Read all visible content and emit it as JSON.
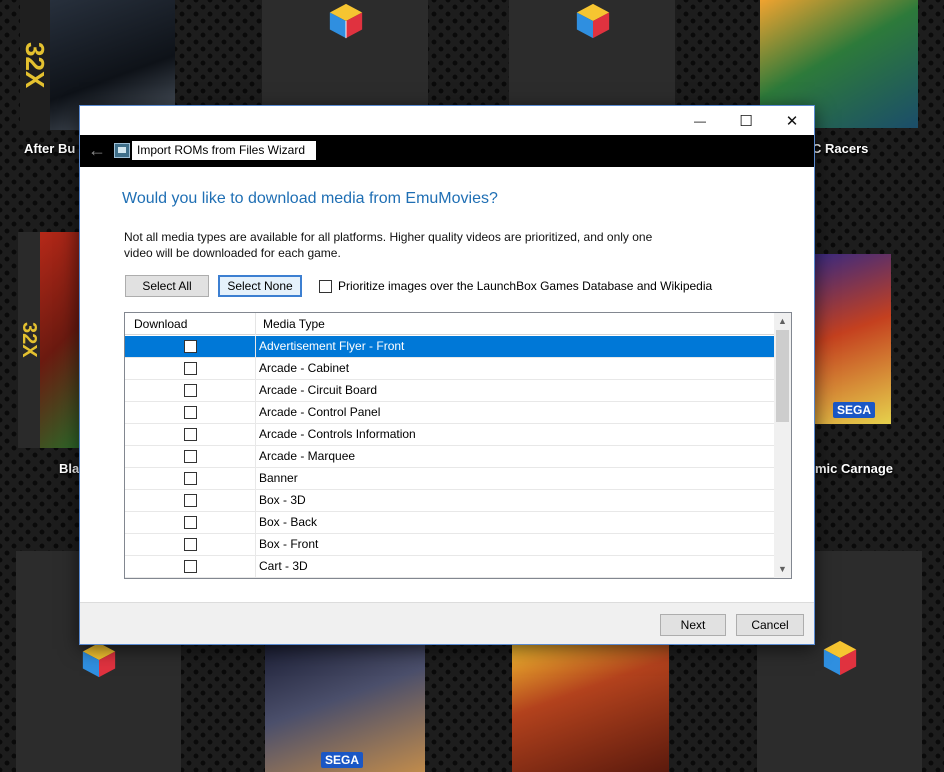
{
  "background": {
    "labels": {
      "after_burner": "After Bu",
      "racers": "C Racers",
      "blackthorne": "Bla",
      "cosmic_carnage": "mic Carnage"
    },
    "cover_marks": {
      "sega_32x": "32X",
      "sega": "SEGA"
    },
    "colors": {
      "backdrop": "#1d1d1d",
      "tile": "#2c2c2c"
    }
  },
  "dialog": {
    "window_controls": {
      "minimize": "—",
      "maximize": "☐",
      "close": "✕"
    },
    "nav": {
      "back": "←",
      "title": "Import ROMs from Files Wizard"
    },
    "heading": "Would you like to download media from EmuMovies?",
    "description": "Not all media types are available for all platforms. Higher quality videos are prioritized, and only one video will be downloaded for each game.",
    "select_all": "Select All",
    "select_none": "Select None",
    "prioritize_label": "Prioritize images over the LaunchBox Games Database and Wikipedia",
    "prioritize_checked": false,
    "grid": {
      "columns": [
        "Download",
        "Media Type"
      ],
      "rows": [
        {
          "media_type": "Advertisement Flyer - Front",
          "checked": false,
          "selected": true
        },
        {
          "media_type": "Arcade - Cabinet",
          "checked": false,
          "selected": false
        },
        {
          "media_type": "Arcade - Circuit Board",
          "checked": false,
          "selected": false
        },
        {
          "media_type": "Arcade - Control Panel",
          "checked": false,
          "selected": false
        },
        {
          "media_type": "Arcade - Controls Information",
          "checked": false,
          "selected": false
        },
        {
          "media_type": "Arcade - Marquee",
          "checked": false,
          "selected": false
        },
        {
          "media_type": "Banner",
          "checked": false,
          "selected": false
        },
        {
          "media_type": "Box - 3D",
          "checked": false,
          "selected": false
        },
        {
          "media_type": "Box - Back",
          "checked": false,
          "selected": false
        },
        {
          "media_type": "Box - Front",
          "checked": false,
          "selected": false
        },
        {
          "media_type": "Cart - 3D",
          "checked": false,
          "selected": false
        }
      ],
      "scroll_up": "▲",
      "scroll_down": "▼"
    },
    "next": "Next",
    "cancel": "Cancel",
    "colors": {
      "accent": "#0078d7",
      "heading": "#1f6fb4"
    }
  }
}
